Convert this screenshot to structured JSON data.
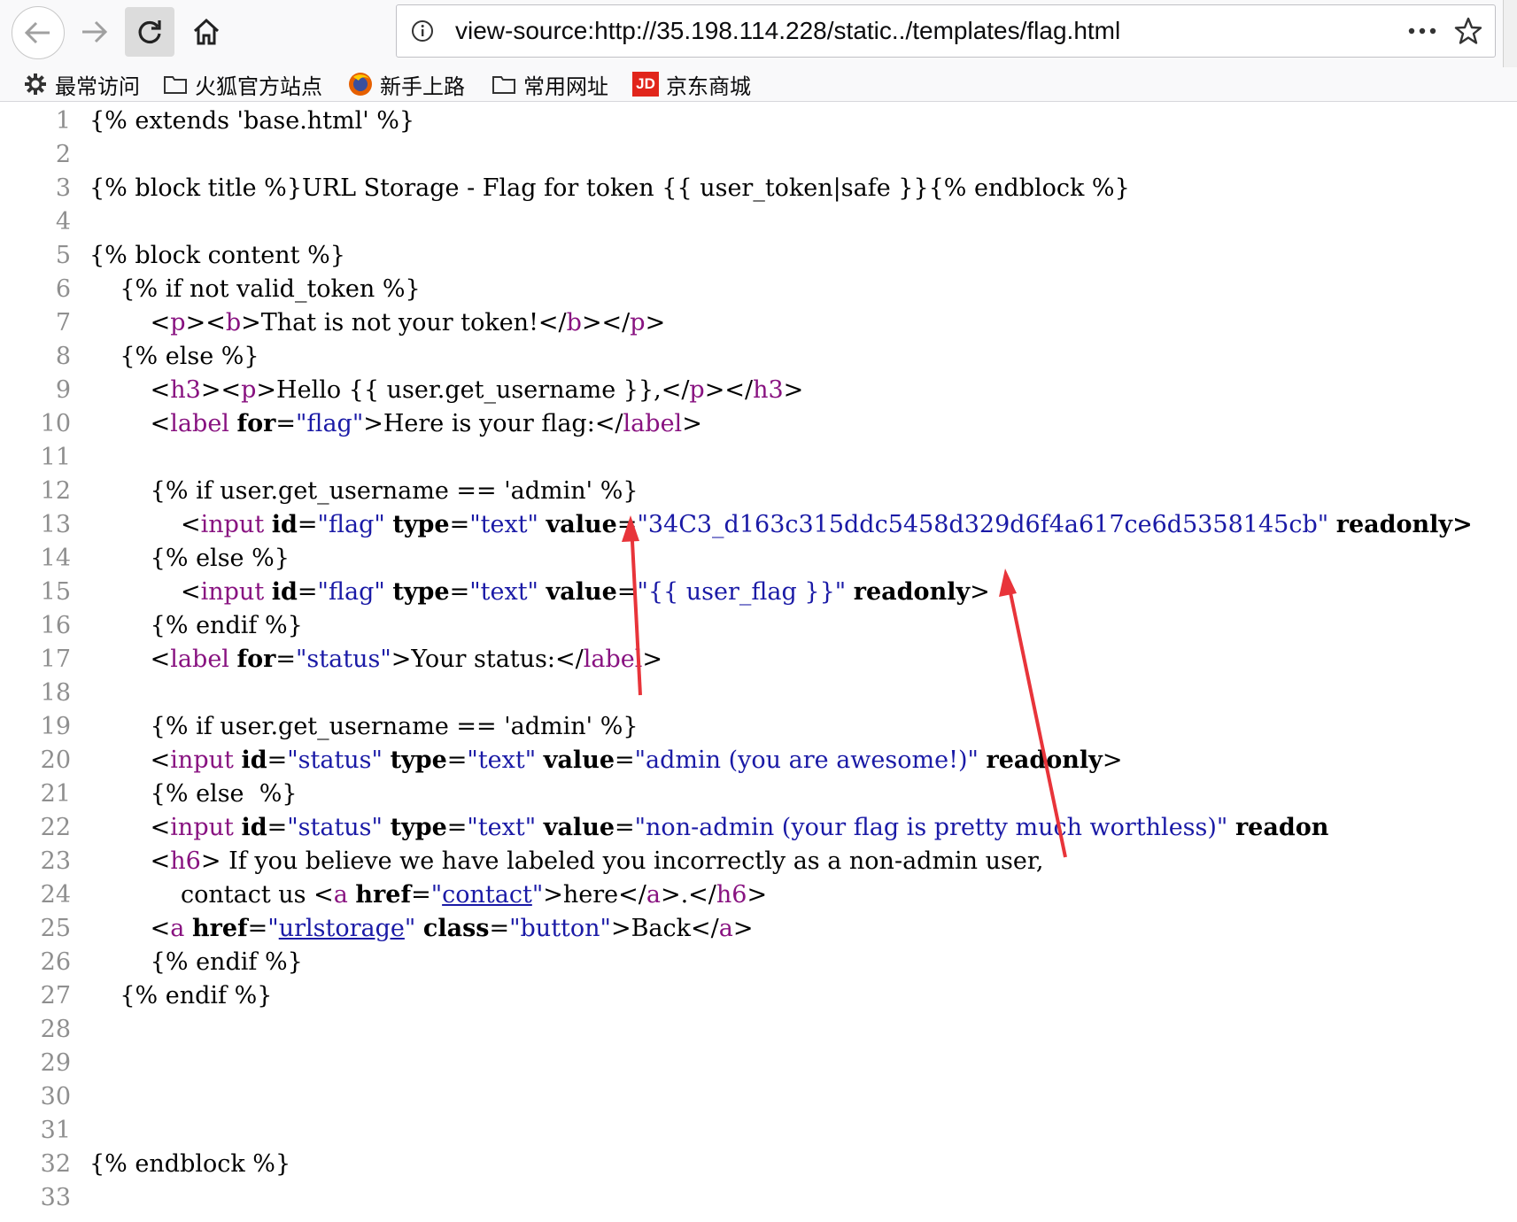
{
  "browser": {
    "url": "view-source:http://35.198.114.228/static../templates/flag.html",
    "bookmarks": [
      "最常访问",
      "火狐官方站点",
      "新手上路",
      "常用网址",
      "京东商城"
    ],
    "jd_badge": "JD"
  },
  "source": {
    "line_numbers": [
      "1",
      "2",
      "3",
      "4",
      "5",
      "6",
      "7",
      "8",
      "9",
      "10",
      "11",
      "12",
      "13",
      "14",
      "15",
      "16",
      "17",
      "18",
      "19",
      "20",
      "21",
      "22",
      "23",
      "24",
      "25",
      "26",
      "27",
      "28",
      "29",
      "30",
      "31",
      "32",
      "33"
    ],
    "t": {
      "l1": "{% extends 'base.html' %}",
      "l3a": "{% block title %}URL Storage - Flag for token {{ user_token|safe }}{% endblock %}",
      "l5": "{% block content %}",
      "l6": "    {% if not valid_token %}",
      "l7_indent": "        ",
      "l7_lt1": "<",
      "l7_p": "p",
      "l7_gt1": "><",
      "l7_b": "b",
      "l7_gt2": ">That is not your token!</",
      "l7_b2": "b",
      "l7_mid": "></",
      "l7_p2": "p",
      "l7_end": ">",
      "l8": "    {% else %}",
      "l9_a": "        <",
      "l9_h3": "h3",
      "l9_b": "><",
      "l9_p": "p",
      "l9_c": ">Hello {{ user.get_username }},</",
      "l9_p2": "p",
      "l9_d": "></",
      "l9_h32": "h3",
      "l9_e": ">",
      "l10_a": "        <",
      "l10_tag": "label",
      "l10_sp": " ",
      "l10_attr": "for",
      "l10_eq": "=",
      "l10_val": "\"flag\"",
      "l10_b": ">Here is your flag:</",
      "l10_tag2": "label",
      "l10_c": ">",
      "l12": "        {% if user.get_username == 'admin' %}",
      "l13_a": "            <",
      "l13_tag": "input",
      "l13_id": "id",
      "l13_idv": "\"flag\"",
      "l13_type": "type",
      "l13_typev": "\"text\"",
      "l13_value": "value",
      "l13_valuev": "\"34C3_d163c315ddc5458d329d6f4a617ce6d5358145cb\"",
      "l13_ro": "readonly>",
      "l14": "        {% else %}",
      "l15_a": "            <",
      "l15_tag": "input",
      "l15_id": "id",
      "l15_idv": "\"flag\"",
      "l15_type": "type",
      "l15_typev": "\"text\"",
      "l15_value": "value",
      "l15_valuev": "\"{{ user_flag }}\"",
      "l15_ro": "readonly",
      "l15_end": ">",
      "l16": "        {% endif %}",
      "l17_a": "        <",
      "l17_tag": "label",
      "l17_attr": "for",
      "l17_val": "\"status\"",
      "l17_b": ">Your status:</",
      "l17_tag2": "label",
      "l17_c": ">",
      "l19": "        {% if user.get_username == 'admin' %}",
      "l20_a": "        <",
      "l20_tag": "input",
      "l20_id": "id",
      "l20_idv": "\"status\"",
      "l20_type": "type",
      "l20_typev": "\"text\"",
      "l20_value": "value",
      "l20_valuev": "\"admin (you are awesome!)\"",
      "l20_ro": "readonly",
      "l20_end": ">",
      "l21": "        {% else  %}",
      "l22_a": "        <",
      "l22_tag": "input",
      "l22_id": "id",
      "l22_idv": "\"status\"",
      "l22_type": "type",
      "l22_typev": "\"text\"",
      "l22_value": "value",
      "l22_valuev": "\"non-admin (your flag is pretty much worthless)\"",
      "l22_ro": "readon",
      "l23_a": "        <",
      "l23_tag": "h6",
      "l23_b": "> If you believe we have labeled you incorrectly as a non-admin user,",
      "l24_a": "            contact us <",
      "l24_tag": "a",
      "l24_attr": "href",
      "l24_q1": "\"",
      "l24_link": "contact",
      "l24_q2": "\"",
      "l24_b": ">here</",
      "l24_tag2": "a",
      "l24_c": ">.</",
      "l24_tag3": "h6",
      "l24_d": ">",
      "l25_a": "        <",
      "l25_tag": "a",
      "l25_attr": "href",
      "l25_q1": "\"",
      "l25_link": "urlstorage",
      "l25_q2": "\"",
      "l25_class": "class",
      "l25_classv": "\"button\"",
      "l25_b": ">Back</",
      "l25_tag2": "a",
      "l25_c": ">",
      "l26": "        {% endif %}",
      "l27": "    {% endif %}",
      "l32": "{% endblock %}"
    }
  },
  "colors": {
    "tag": "#881280",
    "attr_value": "#1a1aa6",
    "line_number": "#8f8f8f",
    "annotation_arrow": "#e8343a"
  }
}
